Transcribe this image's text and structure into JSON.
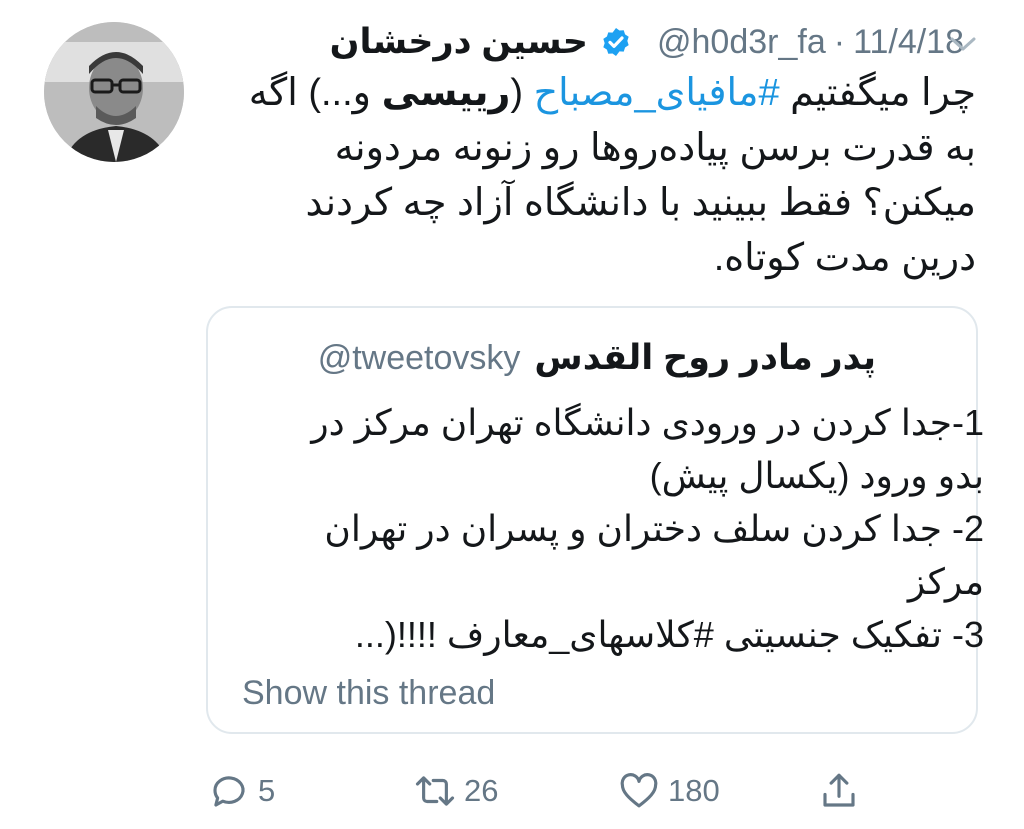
{
  "tweet": {
    "author": {
      "display_name": "حسین درخشان",
      "handle": "@h0d3r_fa",
      "separator": "·",
      "date": "11/4/18",
      "verified": true
    },
    "text": {
      "part1": "چرا میگفتیم ",
      "hashtag": "#مافیای_مصباح",
      "part2": " (",
      "bold": "رییسی",
      "part3": " و...) اگه به قدرت برسن پیاده‌روها رو زنونه مردونه میکنن؟ فقط ببینید با دانشگاه آزاد چه کردند درین مدت کوتاه."
    },
    "quoted": {
      "display_name": "پدر مادر روح القدس",
      "handle": "@tweetovsky",
      "lines": [
        "1-جدا کردن در ورودی دانشگاه تهران مرکز در",
        "بدو ورود (یکسال پیش)",
        "2- جدا کردن سلف دختران و پسران در تهران",
        "مرکز",
        "3- تفکیک جنسیتی #کلاسهای_معارف !!!!(..."
      ],
      "show_thread": "Show this thread"
    },
    "actions": {
      "replies": "5",
      "retweets": "26",
      "likes": "180"
    },
    "icons": [
      "verified-badge-icon",
      "chevron-down-icon",
      "reply-icon",
      "retweet-icon",
      "heart-icon",
      "share-icon"
    ],
    "colors": {
      "hashtag": "#1b95e0",
      "verified": "#1da1f2",
      "muted": "#657786",
      "border": "#e1e8ed"
    }
  }
}
